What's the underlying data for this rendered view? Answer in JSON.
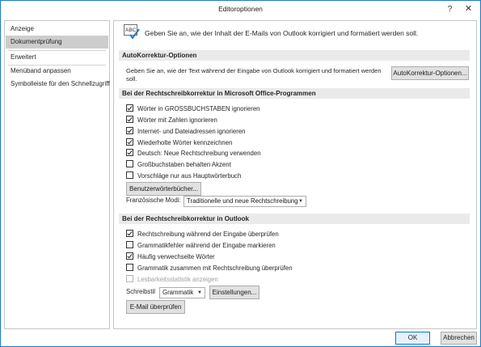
{
  "window": {
    "title": "Editoroptionen",
    "close_glyph": "✕",
    "help_glyph": "?"
  },
  "nav": {
    "items": [
      {
        "label": "Anzeige",
        "active": false
      },
      {
        "label": "Dokumentprüfung",
        "active": true
      },
      {
        "label": "Erweitert",
        "active": false
      },
      {
        "label": "Menüband anpassen",
        "active": false
      },
      {
        "label": "Symbolleiste für den Schnellzugriff",
        "active": false
      }
    ]
  },
  "header": {
    "icon": "abc-check-icon",
    "text": "Geben Sie an, wie der Inhalt der E-Mails von Outlook korrigiert und formatiert werden soll."
  },
  "autocorrect": {
    "section_title": "AutoKorrektur-Optionen",
    "description": "Geben Sie an, wie der Text während der Eingabe von Outlook korrigiert und formatiert werden soll.",
    "button_label": "AutoKorrektur-Optionen..."
  },
  "office_spelling": {
    "section_title": "Bei der Rechtschreibkorrektur in Microsoft Office-Programmen",
    "options": [
      {
        "label": "Wörter in GROSSBUCHSTABEN ignorieren",
        "checked": true
      },
      {
        "label": "Wörter mit Zahlen ignorieren",
        "checked": true
      },
      {
        "label": "Internet- und Dateiadressen ignorieren",
        "checked": true
      },
      {
        "label": "Wiederholte Wörter kennzeichnen",
        "checked": true
      },
      {
        "label": "Deutsch: Neue Rechtschreibung verwenden",
        "checked": true
      },
      {
        "label": "Großbuchstaben behalten Akzent",
        "checked": false
      },
      {
        "label": "Vorschläge nur aus Hauptwörterbuch",
        "checked": false
      }
    ],
    "dictionaries_button": "Benutzerwörterbücher...",
    "french_modes_label": "Französische Modi:",
    "french_modes_value": "Traditionelle und neue Rechtschreibung"
  },
  "outlook_spelling": {
    "section_title": "Bei der Rechtschreibkorrektur in Outlook",
    "options": [
      {
        "label": "Rechtschreibung während der Eingabe überprüfen",
        "checked": true,
        "disabled": false
      },
      {
        "label": "Grammatikfehler während der Eingabe markieren",
        "checked": false,
        "disabled": false
      },
      {
        "label": "Häufig verwechselte Wörter",
        "checked": true,
        "disabled": false
      },
      {
        "label": "Grammatik zusammen mit Rechtschreibung überprüfen",
        "checked": false,
        "disabled": false
      },
      {
        "label": "Lesbarkeitsstatistik anzeigen",
        "checked": false,
        "disabled": true
      }
    ],
    "writing_style_label": "Schreibstil",
    "writing_style_value": "Grammatik",
    "settings_button": "Einstellungen...",
    "check_email_button": "E-Mail überprüfen"
  },
  "footer": {
    "ok_label": "OK",
    "cancel_label": "Abbrechen"
  },
  "colors": {
    "window_border": "#1e7bc8",
    "nav_active_bg": "#cdcdcd",
    "section_bg": "#eaeaea",
    "ok_border": "#0078d7"
  }
}
